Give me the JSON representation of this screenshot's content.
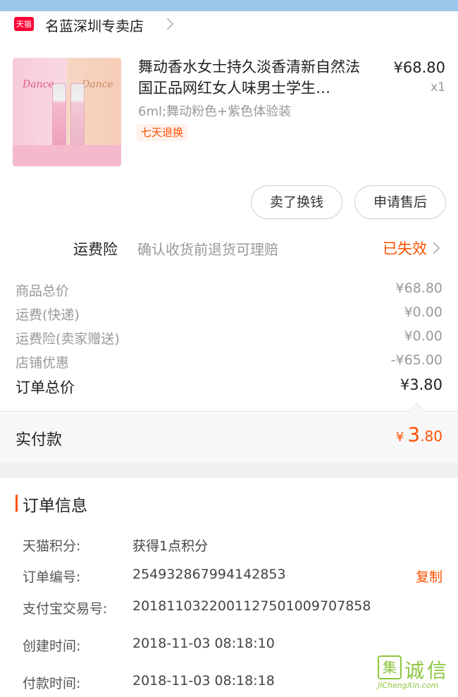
{
  "shop": {
    "badge": "天猫",
    "name": "名蓝深圳专卖店"
  },
  "product": {
    "thumb_label_left": "Dance",
    "thumb_label_right": "Dance",
    "title": "舞动香水女士持久淡香清新自然法国正品网红女人味男士学生…",
    "price": "¥68.80",
    "qty": "x1",
    "sku": "6ml;舞动粉色+紫色体验装",
    "tag": "七天退换"
  },
  "actions": {
    "sell": "卖了换钱",
    "after_sale": "申请售后"
  },
  "insurance": {
    "label": "运费险",
    "desc": "确认收货前退货可理赔",
    "status": "已失效"
  },
  "summary": [
    {
      "label": "商品总价",
      "value": "¥68.80"
    },
    {
      "label": "运费(快递)",
      "value": "¥0.00"
    },
    {
      "label": "运费险(卖家赠送)",
      "value": "¥0.00"
    },
    {
      "label": "店铺优惠",
      "value": "-¥65.00"
    }
  ],
  "order_total": {
    "label": "订单总价",
    "value": "¥3.80"
  },
  "paid": {
    "label": "实付款",
    "currency": "¥",
    "integer": "3",
    "decimal": ".80"
  },
  "info": {
    "title": "订单信息",
    "rows": [
      {
        "label": "天猫积分:",
        "value": "获得1点积分"
      },
      {
        "label": "订单编号:",
        "value": "254932867994142853",
        "action": "复制"
      },
      {
        "label": "支付宝交易号:",
        "value": "2018110322001127501009707858"
      },
      {
        "label": "创建时间:",
        "value": "2018-11-03 08:18:10"
      },
      {
        "label": "付款时间:",
        "value": "2018-11-03 08:18:18"
      }
    ]
  },
  "watermark": {
    "glyph": "集",
    "word": "诚信",
    "url": "JiChengXin.com"
  },
  "colors": {
    "accent": "#ff5000",
    "tmall": "#ff0036",
    "statusbar": "#9cc6ec",
    "watermark": "#8cc63f"
  }
}
